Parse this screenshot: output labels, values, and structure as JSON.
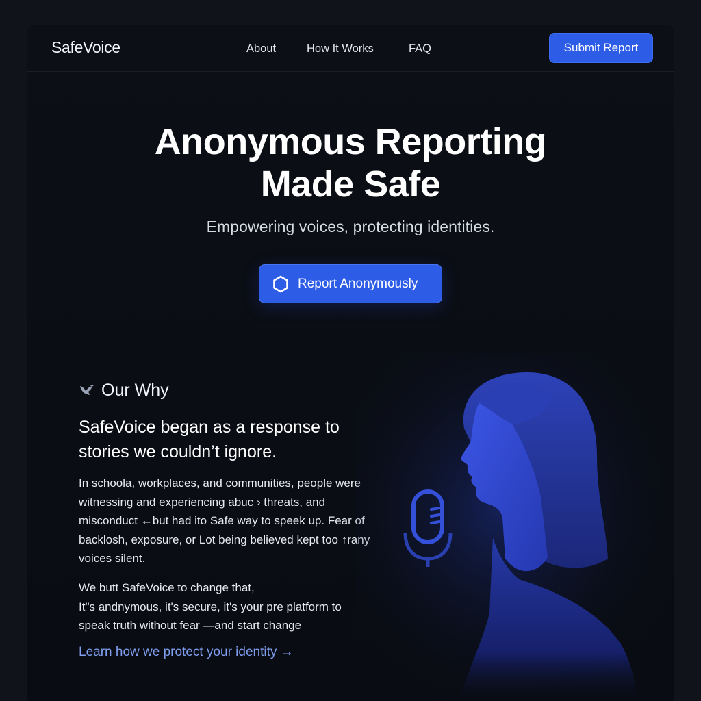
{
  "nav": {
    "brand": "SafeVoice",
    "links": [
      "About",
      "How It Works",
      "FAQ"
    ],
    "cta": "Submit Report"
  },
  "hero": {
    "title_line1": "Anonymous Reporting",
    "title_line2": "Made Safe",
    "subtitle": "Empowering voices, protecting identities.",
    "button_label": "Report Anonymously",
    "button_icon": "shield-hexagon-icon"
  },
  "why": {
    "icon": "bird-icon",
    "heading": "Our Why",
    "lead": "SafeVoice began as a response to stories we couldn’t ignore.",
    "paragraph1": "In schoola, workplaces, and communities, people were witnessing and experiencing abuc › threats, and misconduct ←but had ito Safe way to speek up. Fear of backlosh, exposure, or Lot being believed kept too ↑rany voices silent.",
    "paragraph2": "We butt SafeVoice to change that,\nIt\"s andnymous, it's secure, it's your pre platform to speak truth without fear —and start change",
    "link": "Learn how we protect your identity →"
  },
  "illustration": {
    "subject": "silhouette-speaking-into-microphone"
  },
  "colors": {
    "page_bg": "#10131a",
    "panel_bg": "#0b0e14",
    "accent": "#2d5ce6",
    "link": "#7f9ef0",
    "text": "#ffffff"
  }
}
